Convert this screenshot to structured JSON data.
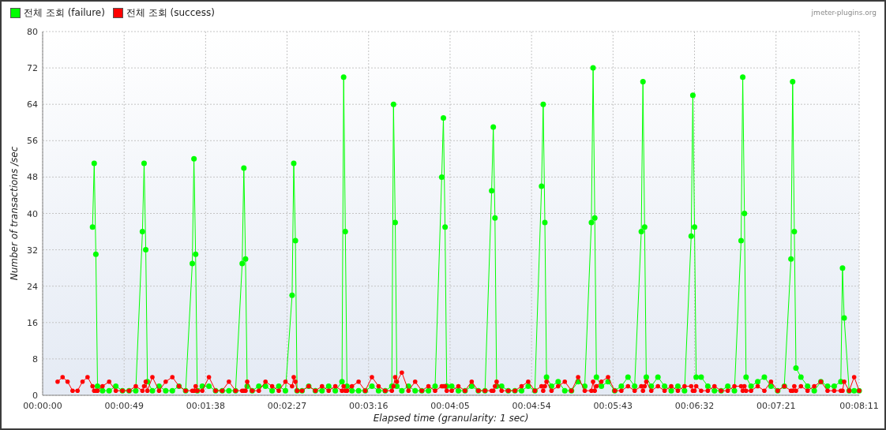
{
  "chart": {
    "credit": "jmeter-plugins.org",
    "chart_data": {
      "type": "line",
      "xlabel": "Elapsed time (granularity: 1 sec)",
      "ylabel": "Number of transactions /sec",
      "x": [
        9,
        12,
        15,
        18,
        21,
        24,
        27,
        30,
        31,
        32,
        33,
        36,
        40,
        44,
        48,
        52,
        56,
        60,
        61,
        62,
        63,
        66,
        70,
        74,
        78,
        82,
        86,
        90,
        91,
        92,
        93,
        96,
        100,
        104,
        108,
        112,
        116,
        120,
        121,
        122,
        123,
        126,
        130,
        134,
        138,
        142,
        146,
        150,
        151,
        152,
        153,
        156,
        160,
        164,
        168,
        172,
        176,
        180,
        181,
        182,
        183,
        186,
        190,
        194,
        198,
        202,
        206,
        210,
        211,
        212,
        213,
        216,
        220,
        224,
        228,
        232,
        236,
        240,
        241,
        242,
        243,
        246,
        250,
        254,
        258,
        262,
        266,
        270,
        271,
        272,
        273,
        276,
        280,
        284,
        288,
        292,
        296,
        300,
        301,
        302,
        303,
        306,
        310,
        314,
        318,
        322,
        326,
        330,
        331,
        332,
        333,
        336,
        340,
        344,
        348,
        352,
        356,
        360,
        361,
        362,
        363,
        366,
        370,
        374,
        378,
        382,
        386,
        390,
        391,
        392,
        393,
        396,
        400,
        404,
        408,
        412,
        416,
        420,
        421,
        422,
        423,
        426,
        430,
        434,
        438,
        442,
        446,
        450,
        451,
        452,
        453,
        456,
        460,
        464,
        468,
        472,
        476,
        480,
        481,
        482,
        485,
        488,
        491
      ],
      "series": [
        {
          "name": "전체 조회 (failure)",
          "color": "#00ff00",
          "marker": "circle",
          "values": [
            null,
            null,
            null,
            null,
            null,
            null,
            null,
            37,
            51,
            31,
            2,
            1,
            1,
            2,
            1,
            1,
            1,
            36,
            51,
            32,
            3,
            1,
            2,
            1,
            1,
            2,
            1,
            29,
            52,
            31,
            1,
            2,
            2,
            1,
            1,
            1,
            1,
            29,
            50,
            30,
            2,
            1,
            2,
            2,
            1,
            2,
            1,
            22,
            51,
            34,
            1,
            1,
            2,
            1,
            1,
            2,
            1,
            3,
            70,
            36,
            2,
            1,
            1,
            1,
            2,
            1,
            1,
            2,
            64,
            38,
            2,
            1,
            2,
            1,
            1,
            1,
            2,
            48,
            61,
            37,
            2,
            2,
            1,
            1,
            2,
            1,
            1,
            45,
            59,
            39,
            2,
            2,
            1,
            1,
            1,
            2,
            1,
            46,
            64,
            38,
            4,
            2,
            3,
            1,
            1,
            3,
            2,
            38,
            72,
            39,
            4,
            2,
            3,
            1,
            2,
            4,
            2,
            36,
            69,
            37,
            4,
            2,
            4,
            2,
            1,
            2,
            1,
            35,
            66,
            37,
            4,
            4,
            2,
            1,
            1,
            2,
            1,
            34,
            70,
            40,
            4,
            2,
            3,
            4,
            2,
            1,
            2,
            30,
            69,
            36,
            6,
            4,
            2,
            1,
            3,
            2,
            2,
            3,
            28,
            17,
            1,
            1,
            1
          ]
        },
        {
          "name": "전체 조회 (success)",
          "color": "#ff0000",
          "values": [
            3,
            4,
            3,
            1,
            1,
            3,
            4,
            2,
            1,
            1,
            1,
            2,
            3,
            1,
            1,
            1,
            2,
            1,
            2,
            3,
            1,
            4,
            1,
            3,
            4,
            2,
            1,
            1,
            1,
            2,
            1,
            1,
            4,
            1,
            1,
            3,
            1,
            1,
            1,
            1,
            3,
            1,
            1,
            3,
            2,
            1,
            3,
            2,
            4,
            3,
            1,
            1,
            2,
            1,
            2,
            1,
            2,
            1,
            2,
            1,
            1,
            2,
            3,
            1,
            4,
            2,
            1,
            1,
            2,
            4,
            3,
            5,
            1,
            3,
            1,
            2,
            1,
            2,
            2,
            2,
            1,
            1,
            2,
            1,
            3,
            1,
            1,
            1,
            1,
            2,
            3,
            1,
            1,
            1,
            2,
            3,
            1,
            2,
            1,
            2,
            3,
            1,
            2,
            3,
            1,
            4,
            1,
            1,
            3,
            1,
            2,
            3,
            4,
            1,
            1,
            2,
            1,
            2,
            1,
            2,
            3,
            1,
            2,
            1,
            2,
            1,
            2,
            2,
            1,
            1,
            2,
            1,
            1,
            2,
            1,
            1,
            2,
            2,
            1,
            2,
            1,
            1,
            2,
            1,
            3,
            1,
            2,
            1,
            1,
            2,
            1,
            2,
            1,
            2,
            3,
            1,
            1,
            1,
            1,
            3,
            1,
            4,
            1
          ]
        }
      ],
      "xlim": [
        0,
        491
      ],
      "ylim": [
        0,
        80
      ],
      "xticks": [
        {
          "value": 0,
          "label": "00:00:00"
        },
        {
          "value": 49,
          "label": "00:00:49"
        },
        {
          "value": 98,
          "label": "00:01:38"
        },
        {
          "value": 147,
          "label": "00:02:27"
        },
        {
          "value": 196,
          "label": "00:03:16"
        },
        {
          "value": 245,
          "label": "00:04:05"
        },
        {
          "value": 294,
          "label": "00:04:54"
        },
        {
          "value": 343,
          "label": "00:05:43"
        },
        {
          "value": 392,
          "label": "00:06:32"
        },
        {
          "value": 441,
          "label": "00:07:21"
        },
        {
          "value": 491,
          "label": "00:08:11"
        }
      ],
      "yticks": [
        0,
        8,
        16,
        24,
        32,
        40,
        48,
        56,
        64,
        72,
        80
      ],
      "grid": true,
      "legend": true
    }
  }
}
